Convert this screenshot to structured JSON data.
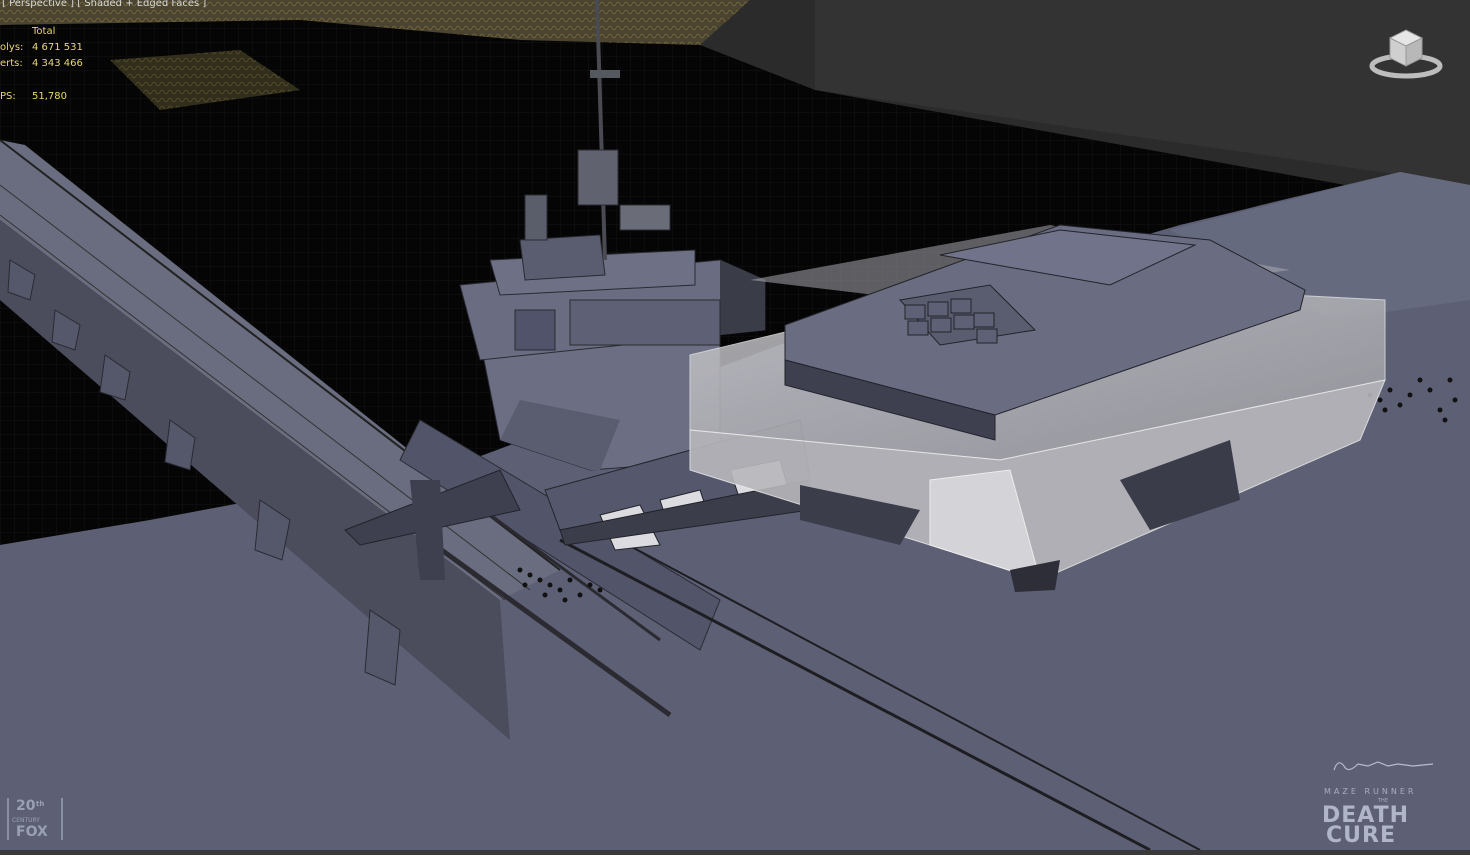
{
  "viewport": {
    "label": "[ Perspective ] [ Shaded + Edged Faces ]",
    "mode": "Perspective",
    "shading": "Shaded + Edged Faces"
  },
  "stats": {
    "header": "Total",
    "polys_label": "olys:",
    "polys_value": "4 671 531",
    "verts_label": "erts:",
    "verts_value": "4 343 466",
    "fps_label": "PS:",
    "fps_value": "51,780"
  },
  "navcube": {
    "icon": "viewcube-icon"
  },
  "branding": {
    "studio_logo": "20th Century Fox",
    "signature": "Zabrocki",
    "title_small": "MAZE RUNNER",
    "title_the": "THE",
    "title_line1": "DEATH",
    "title_line2": "CURE"
  },
  "colors": {
    "water": "#050505",
    "ground": "#5d6075",
    "stats_text": "#e8d870",
    "label_text": "#d8d8d8"
  }
}
